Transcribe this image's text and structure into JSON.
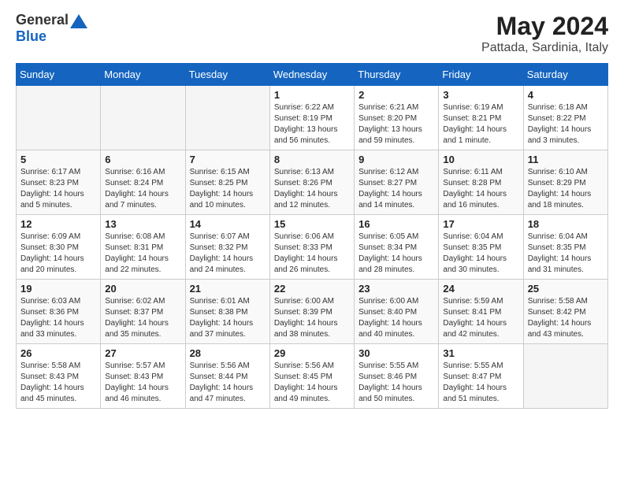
{
  "header": {
    "logo_general": "General",
    "logo_blue": "Blue",
    "month_year": "May 2024",
    "location": "Pattada, Sardinia, Italy"
  },
  "weekdays": [
    "Sunday",
    "Monday",
    "Tuesday",
    "Wednesday",
    "Thursday",
    "Friday",
    "Saturday"
  ],
  "weeks": [
    [
      {
        "day": "",
        "info": ""
      },
      {
        "day": "",
        "info": ""
      },
      {
        "day": "",
        "info": ""
      },
      {
        "day": "1",
        "info": "Sunrise: 6:22 AM\nSunset: 8:19 PM\nDaylight: 13 hours\nand 56 minutes."
      },
      {
        "day": "2",
        "info": "Sunrise: 6:21 AM\nSunset: 8:20 PM\nDaylight: 13 hours\nand 59 minutes."
      },
      {
        "day": "3",
        "info": "Sunrise: 6:19 AM\nSunset: 8:21 PM\nDaylight: 14 hours\nand 1 minute."
      },
      {
        "day": "4",
        "info": "Sunrise: 6:18 AM\nSunset: 8:22 PM\nDaylight: 14 hours\nand 3 minutes."
      }
    ],
    [
      {
        "day": "5",
        "info": "Sunrise: 6:17 AM\nSunset: 8:23 PM\nDaylight: 14 hours\nand 5 minutes."
      },
      {
        "day": "6",
        "info": "Sunrise: 6:16 AM\nSunset: 8:24 PM\nDaylight: 14 hours\nand 7 minutes."
      },
      {
        "day": "7",
        "info": "Sunrise: 6:15 AM\nSunset: 8:25 PM\nDaylight: 14 hours\nand 10 minutes."
      },
      {
        "day": "8",
        "info": "Sunrise: 6:13 AM\nSunset: 8:26 PM\nDaylight: 14 hours\nand 12 minutes."
      },
      {
        "day": "9",
        "info": "Sunrise: 6:12 AM\nSunset: 8:27 PM\nDaylight: 14 hours\nand 14 minutes."
      },
      {
        "day": "10",
        "info": "Sunrise: 6:11 AM\nSunset: 8:28 PM\nDaylight: 14 hours\nand 16 minutes."
      },
      {
        "day": "11",
        "info": "Sunrise: 6:10 AM\nSunset: 8:29 PM\nDaylight: 14 hours\nand 18 minutes."
      }
    ],
    [
      {
        "day": "12",
        "info": "Sunrise: 6:09 AM\nSunset: 8:30 PM\nDaylight: 14 hours\nand 20 minutes."
      },
      {
        "day": "13",
        "info": "Sunrise: 6:08 AM\nSunset: 8:31 PM\nDaylight: 14 hours\nand 22 minutes."
      },
      {
        "day": "14",
        "info": "Sunrise: 6:07 AM\nSunset: 8:32 PM\nDaylight: 14 hours\nand 24 minutes."
      },
      {
        "day": "15",
        "info": "Sunrise: 6:06 AM\nSunset: 8:33 PM\nDaylight: 14 hours\nand 26 minutes."
      },
      {
        "day": "16",
        "info": "Sunrise: 6:05 AM\nSunset: 8:34 PM\nDaylight: 14 hours\nand 28 minutes."
      },
      {
        "day": "17",
        "info": "Sunrise: 6:04 AM\nSunset: 8:35 PM\nDaylight: 14 hours\nand 30 minutes."
      },
      {
        "day": "18",
        "info": "Sunrise: 6:04 AM\nSunset: 8:35 PM\nDaylight: 14 hours\nand 31 minutes."
      }
    ],
    [
      {
        "day": "19",
        "info": "Sunrise: 6:03 AM\nSunset: 8:36 PM\nDaylight: 14 hours\nand 33 minutes."
      },
      {
        "day": "20",
        "info": "Sunrise: 6:02 AM\nSunset: 8:37 PM\nDaylight: 14 hours\nand 35 minutes."
      },
      {
        "day": "21",
        "info": "Sunrise: 6:01 AM\nSunset: 8:38 PM\nDaylight: 14 hours\nand 37 minutes."
      },
      {
        "day": "22",
        "info": "Sunrise: 6:00 AM\nSunset: 8:39 PM\nDaylight: 14 hours\nand 38 minutes."
      },
      {
        "day": "23",
        "info": "Sunrise: 6:00 AM\nSunset: 8:40 PM\nDaylight: 14 hours\nand 40 minutes."
      },
      {
        "day": "24",
        "info": "Sunrise: 5:59 AM\nSunset: 8:41 PM\nDaylight: 14 hours\nand 42 minutes."
      },
      {
        "day": "25",
        "info": "Sunrise: 5:58 AM\nSunset: 8:42 PM\nDaylight: 14 hours\nand 43 minutes."
      }
    ],
    [
      {
        "day": "26",
        "info": "Sunrise: 5:58 AM\nSunset: 8:43 PM\nDaylight: 14 hours\nand 45 minutes."
      },
      {
        "day": "27",
        "info": "Sunrise: 5:57 AM\nSunset: 8:43 PM\nDaylight: 14 hours\nand 46 minutes."
      },
      {
        "day": "28",
        "info": "Sunrise: 5:56 AM\nSunset: 8:44 PM\nDaylight: 14 hours\nand 47 minutes."
      },
      {
        "day": "29",
        "info": "Sunrise: 5:56 AM\nSunset: 8:45 PM\nDaylight: 14 hours\nand 49 minutes."
      },
      {
        "day": "30",
        "info": "Sunrise: 5:55 AM\nSunset: 8:46 PM\nDaylight: 14 hours\nand 50 minutes."
      },
      {
        "day": "31",
        "info": "Sunrise: 5:55 AM\nSunset: 8:47 PM\nDaylight: 14 hours\nand 51 minutes."
      },
      {
        "day": "",
        "info": ""
      }
    ]
  ]
}
